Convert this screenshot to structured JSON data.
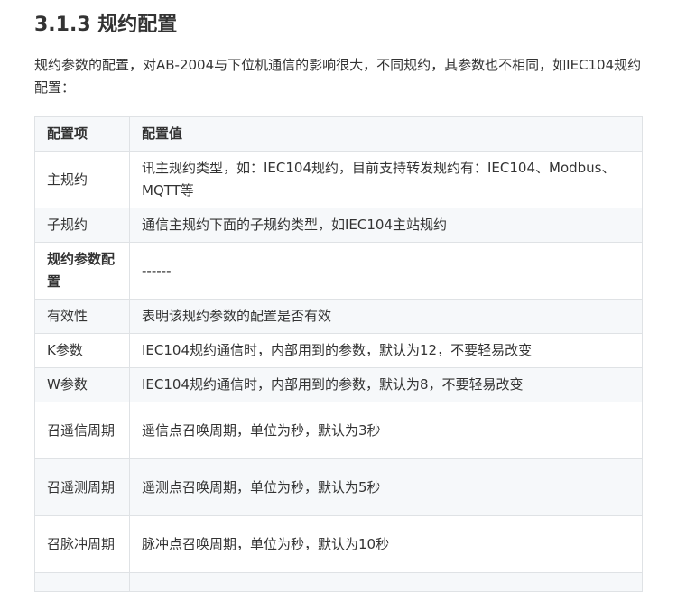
{
  "section": {
    "heading": "3.1.3 规约配置",
    "intro": "规约参数的配置，对AB-2004与下位机通信的影响很大，不同规约，其参数也不相同，如IEC104规约配置："
  },
  "table": {
    "headers": [
      "配置项",
      "配置值"
    ],
    "rows": [
      {
        "key": "主规约",
        "value": "讯主规约类型，如：IEC104规约，目前支持转发规约有：IEC104、Modbus、MQTT等"
      },
      {
        "key": "子规约",
        "value": "通信主规约下面的子规约类型，如IEC104主站规约"
      },
      {
        "key": "规约参数配置",
        "value": "------"
      },
      {
        "key": "有效性",
        "value": "表明该规约参数的配置是否有效"
      },
      {
        "key": "K参数",
        "value": "IEC104规约通信时，内部用到的参数，默认为12，不要轻易改变"
      },
      {
        "key": "W参数",
        "value": "IEC104规约通信时，内部用到的参数，默认为8，不要轻易改变"
      },
      {
        "key": "召遥信周期",
        "value": "遥信点召唤周期，单位为秒，默认为3秒"
      },
      {
        "key": "召遥测周期",
        "value": "遥测点召唤周期，单位为秒，默认为5秒"
      },
      {
        "key": "召脉冲周期",
        "value": "脉冲点召唤周期，单位为秒，默认为10秒"
      }
    ]
  }
}
